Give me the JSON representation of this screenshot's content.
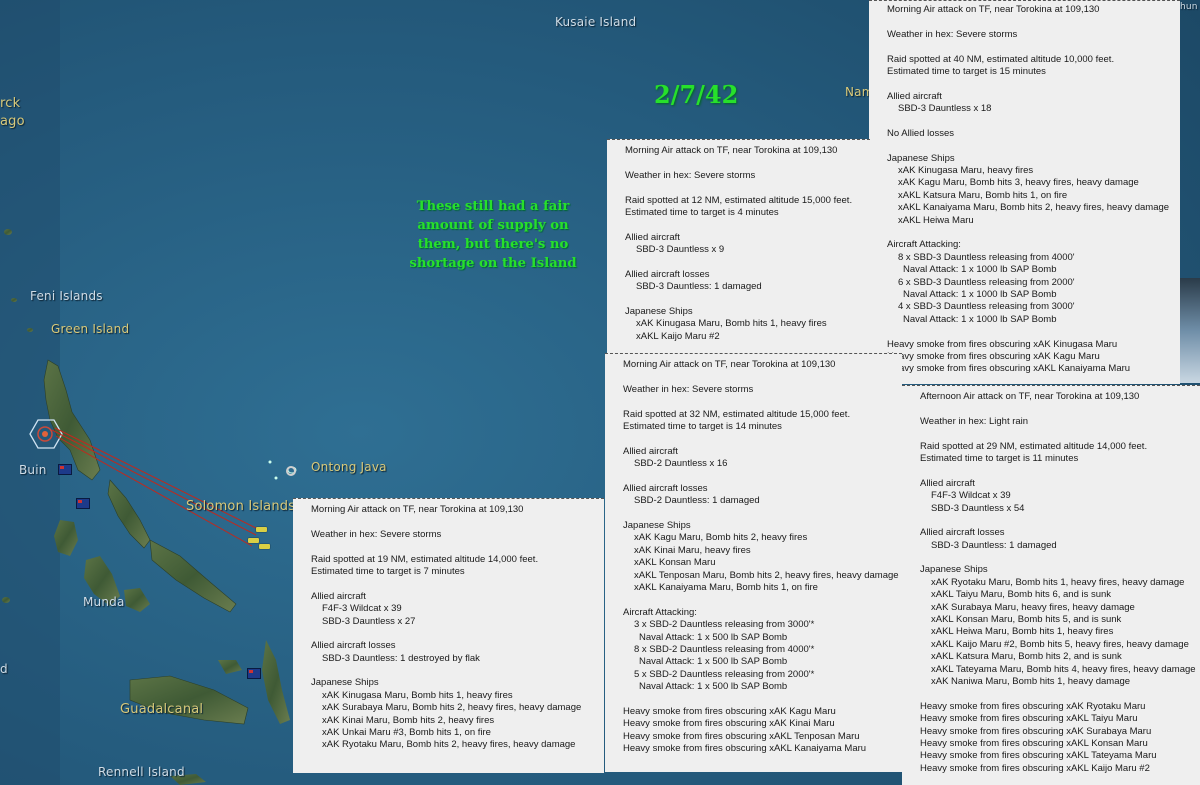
{
  "map": {
    "date": "2/7/42",
    "note": "These still had a fair amount of supply on them, but there's no shortage on the Island",
    "places": {
      "kusaie": "Kusaie Island",
      "nam": "Nam",
      "bismarck_a": "rck",
      "bismarck_b": "ago",
      "feni": "Feni Islands",
      "green": "Green Island",
      "buin": "Buin",
      "ontong": "Ontong Java",
      "solomon": "Solomon Islands",
      "munda": "Munda",
      "guadalcanal": "Guadalcanal",
      "rennell": "Rennell Island",
      "edge_d": "d",
      "edge_hun": "hun"
    }
  },
  "reports": [
    {
      "id": "r1",
      "lines": [
        {
          "t": "Morning Air attack on TF, near Torokina at 109,130",
          "i": 0
        },
        {
          "t": "",
          "i": 0
        },
        {
          "t": "Weather in hex: Severe storms",
          "i": 0
        },
        {
          "t": "",
          "i": 0
        },
        {
          "t": "Raid spotted at 40 NM, estimated altitude 10,000 feet.",
          "i": 0
        },
        {
          "t": "Estimated time to target is 15 minutes",
          "i": 0
        },
        {
          "t": "",
          "i": 0
        },
        {
          "t": "Allied aircraft",
          "i": 0
        },
        {
          "t": "SBD-3 Dauntless x 18",
          "i": 1
        },
        {
          "t": "",
          "i": 0
        },
        {
          "t": "No Allied losses",
          "i": 0
        },
        {
          "t": "",
          "i": 0
        },
        {
          "t": "Japanese Ships",
          "i": 0
        },
        {
          "t": "xAK Kinugasa Maru, heavy fires",
          "i": 1
        },
        {
          "t": "xAK Kagu Maru, Bomb hits 3, heavy fires, heavy damage",
          "i": 1
        },
        {
          "t": "xAKL Katsura Maru, Bomb hits 1, on fire",
          "i": 1
        },
        {
          "t": "xAKL Kanaiyama Maru, Bomb hits 2, heavy fires, heavy damage",
          "i": 1
        },
        {
          "t": "xAKL Heiwa Maru",
          "i": 1
        },
        {
          "t": "",
          "i": 0
        },
        {
          "t": "Aircraft Attacking:",
          "i": 0
        },
        {
          "t": "8 x SBD-3 Dauntless releasing from 4000'",
          "i": 1
        },
        {
          "t": "Naval Attack:  1 x 1000 lb SAP Bomb",
          "i": 2
        },
        {
          "t": "6 x SBD-3 Dauntless releasing from 2000'",
          "i": 1
        },
        {
          "t": "Naval Attack:  1 x 1000 lb SAP Bomb",
          "i": 2
        },
        {
          "t": "4 x SBD-3 Dauntless releasing from 3000'",
          "i": 1
        },
        {
          "t": "Naval Attack:  1 x 1000 lb SAP Bomb",
          "i": 2
        },
        {
          "t": "",
          "i": 0
        },
        {
          "t": "Heavy smoke from fires obscuring xAK Kinugasa Maru",
          "i": 0
        },
        {
          "t": "Heavy smoke from fires obscuring xAK Kagu Maru",
          "i": 0
        },
        {
          "t": "Heavy smoke from fires obscuring xAKL Kanaiyama Maru",
          "i": 0
        }
      ]
    },
    {
      "id": "r2",
      "lines": [
        {
          "t": "Morning Air attack on TF, near Torokina at 109,130",
          "i": 0
        },
        {
          "t": "",
          "i": 0
        },
        {
          "t": "Weather in hex: Severe storms",
          "i": 0
        },
        {
          "t": "",
          "i": 0
        },
        {
          "t": "Raid spotted at 12 NM, estimated altitude 15,000 feet.",
          "i": 0
        },
        {
          "t": "Estimated time to target is 4 minutes",
          "i": 0
        },
        {
          "t": "",
          "i": 0
        },
        {
          "t": "Allied aircraft",
          "i": 0
        },
        {
          "t": "SBD-3 Dauntless x 9",
          "i": 1
        },
        {
          "t": "",
          "i": 0
        },
        {
          "t": "Allied aircraft losses",
          "i": 0
        },
        {
          "t": "SBD-3 Dauntless: 1 damaged",
          "i": 1
        },
        {
          "t": "",
          "i": 0
        },
        {
          "t": "Japanese Ships",
          "i": 0
        },
        {
          "t": "xAK Kinugasa Maru, Bomb hits 1, heavy fires",
          "i": 1
        },
        {
          "t": "xAKL Kaijo Maru #2",
          "i": 1
        }
      ]
    },
    {
      "id": "r3",
      "lines": [
        {
          "t": "Morning Air attack on TF, near Torokina at 109,130",
          "i": 0
        },
        {
          "t": "",
          "i": 0
        },
        {
          "t": "Weather in hex: Severe storms",
          "i": 0
        },
        {
          "t": "",
          "i": 0
        },
        {
          "t": "Raid spotted at 32 NM, estimated altitude 15,000 feet.",
          "i": 0
        },
        {
          "t": "Estimated time to target is 14 minutes",
          "i": 0
        },
        {
          "t": "",
          "i": 0
        },
        {
          "t": "Allied aircraft",
          "i": 0
        },
        {
          "t": "SBD-2 Dauntless x 16",
          "i": 1
        },
        {
          "t": "",
          "i": 0
        },
        {
          "t": "Allied aircraft losses",
          "i": 0
        },
        {
          "t": "SBD-2 Dauntless: 1 damaged",
          "i": 1
        },
        {
          "t": "",
          "i": 0
        },
        {
          "t": "Japanese Ships",
          "i": 0
        },
        {
          "t": "xAK Kagu Maru, Bomb hits 2, heavy fires",
          "i": 1
        },
        {
          "t": "xAK Kinai Maru, heavy fires",
          "i": 1
        },
        {
          "t": "xAKL Konsan Maru",
          "i": 1
        },
        {
          "t": "xAKL Tenposan Maru, Bomb hits 2, heavy fires, heavy damage",
          "i": 1
        },
        {
          "t": "xAKL Kanaiyama Maru, Bomb hits 1, on fire",
          "i": 1
        },
        {
          "t": "",
          "i": 0
        },
        {
          "t": "Aircraft Attacking:",
          "i": 0
        },
        {
          "t": "3 x SBD-2 Dauntless releasing from 3000'*",
          "i": 1
        },
        {
          "t": "Naval Attack:  1 x 500 lb SAP Bomb",
          "i": 2
        },
        {
          "t": "8 x SBD-2 Dauntless releasing from 4000'*",
          "i": 1
        },
        {
          "t": "Naval Attack:  1 x 500 lb SAP Bomb",
          "i": 2
        },
        {
          "t": "5 x SBD-2 Dauntless releasing from 2000'*",
          "i": 1
        },
        {
          "t": "Naval Attack:  1 x 500 lb SAP Bomb",
          "i": 2
        },
        {
          "t": "",
          "i": 0
        },
        {
          "t": "Heavy smoke from fires obscuring xAK Kagu Maru",
          "i": 0
        },
        {
          "t": "Heavy smoke from fires obscuring xAK Kinai Maru",
          "i": 0
        },
        {
          "t": "Heavy smoke from fires obscuring xAKL Tenposan Maru",
          "i": 0
        },
        {
          "t": "Heavy smoke from fires obscuring xAKL Kanaiyama Maru",
          "i": 0
        }
      ]
    },
    {
      "id": "r4",
      "lines": [
        {
          "t": "Afternoon Air attack on TF, near Torokina at 109,130",
          "i": 0
        },
        {
          "t": "",
          "i": 0
        },
        {
          "t": "Weather in hex: Light rain",
          "i": 0
        },
        {
          "t": "",
          "i": 0
        },
        {
          "t": "Raid spotted at 29 NM, estimated altitude 14,000 feet.",
          "i": 0
        },
        {
          "t": "Estimated time to target is 11 minutes",
          "i": 0
        },
        {
          "t": "",
          "i": 0
        },
        {
          "t": "Allied aircraft",
          "i": 0
        },
        {
          "t": "F4F-3 Wildcat x 39",
          "i": 1
        },
        {
          "t": "SBD-3 Dauntless x 54",
          "i": 1
        },
        {
          "t": "",
          "i": 0
        },
        {
          "t": "Allied aircraft losses",
          "i": 0
        },
        {
          "t": "SBD-3 Dauntless: 1 damaged",
          "i": 1
        },
        {
          "t": "",
          "i": 0
        },
        {
          "t": "Japanese Ships",
          "i": 0
        },
        {
          "t": "xAK Ryotaku Maru, Bomb hits 1, heavy fires, heavy damage",
          "i": 1
        },
        {
          "t": "xAKL Taiyu Maru, Bomb hits 6, and is sunk",
          "i": 1
        },
        {
          "t": "xAK Surabaya Maru, heavy fires, heavy damage",
          "i": 1
        },
        {
          "t": "xAKL Konsan Maru, Bomb hits 5, and is sunk",
          "i": 1
        },
        {
          "t": "xAKL Heiwa Maru, Bomb hits 1, heavy fires",
          "i": 1
        },
        {
          "t": "xAKL Kaijo Maru #2, Bomb hits 5, heavy fires, heavy damage",
          "i": 1
        },
        {
          "t": "xAKL Katsura Maru, Bomb hits 2, and is sunk",
          "i": 1
        },
        {
          "t": "xAKL Tateyama Maru, Bomb hits 4, heavy fires, heavy damage",
          "i": 1
        },
        {
          "t": "xAK Naniwa Maru, Bomb hits 1, heavy damage",
          "i": 1
        },
        {
          "t": "",
          "i": 0
        },
        {
          "t": "Heavy smoke from fires obscuring xAK Ryotaku Maru",
          "i": 0
        },
        {
          "t": "Heavy smoke from fires obscuring xAKL Taiyu Maru",
          "i": 0
        },
        {
          "t": "Heavy smoke from fires obscuring xAK Surabaya Maru",
          "i": 0
        },
        {
          "t": "Heavy smoke from fires obscuring xAKL Konsan Maru",
          "i": 0
        },
        {
          "t": "Heavy smoke from fires obscuring xAKL Tateyama Maru",
          "i": 0
        },
        {
          "t": "Heavy smoke from fires obscuring xAKL Kaijo Maru #2",
          "i": 0
        }
      ]
    },
    {
      "id": "r5",
      "lines": [
        {
          "t": "Morning Air attack on TF, near Torokina at 109,130",
          "i": 0
        },
        {
          "t": "",
          "i": 0
        },
        {
          "t": "Weather in hex: Severe storms",
          "i": 0
        },
        {
          "t": "",
          "i": 0
        },
        {
          "t": "Raid spotted at 19 NM, estimated altitude 14,000 feet.",
          "i": 0
        },
        {
          "t": "Estimated time to target is 7 minutes",
          "i": 0
        },
        {
          "t": "",
          "i": 0
        },
        {
          "t": "Allied aircraft",
          "i": 0
        },
        {
          "t": "F4F-3 Wildcat x 39",
          "i": 1
        },
        {
          "t": "SBD-3 Dauntless x 27",
          "i": 1
        },
        {
          "t": "",
          "i": 0
        },
        {
          "t": "Allied aircraft losses",
          "i": 0
        },
        {
          "t": "SBD-3 Dauntless: 1 destroyed by flak",
          "i": 1
        },
        {
          "t": "",
          "i": 0
        },
        {
          "t": "Japanese Ships",
          "i": 0
        },
        {
          "t": "xAK Kinugasa Maru, Bomb hits 1, heavy fires",
          "i": 1
        },
        {
          "t": "xAK Surabaya Maru, Bomb hits 2, heavy fires, heavy damage",
          "i": 1
        },
        {
          "t": "xAK Kinai Maru, Bomb hits 2, heavy fires",
          "i": 1
        },
        {
          "t": "xAK Unkai Maru #3, Bomb hits 1, on fire",
          "i": 1
        },
        {
          "t": "xAK Ryotaku Maru, Bomb hits 2, heavy fires, heavy damage",
          "i": 1
        }
      ]
    }
  ]
}
